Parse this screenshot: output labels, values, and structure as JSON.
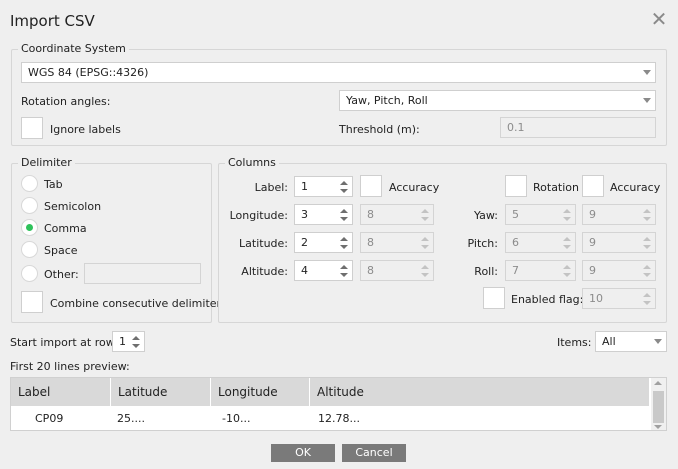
{
  "window": {
    "title": "Import CSV"
  },
  "coordinate_system": {
    "legend": "Coordinate System",
    "value": "WGS 84 (EPSG::4326)",
    "rotation_label": "Rotation angles:",
    "rotation_value": "Yaw, Pitch, Roll",
    "ignore_labels": "Ignore labels",
    "threshold_label": "Threshold (m):",
    "threshold_value": "0.1"
  },
  "delimiter": {
    "legend": "Delimiter",
    "options": [
      "Tab",
      "Semicolon",
      "Comma",
      "Space",
      "Other:"
    ],
    "selected": "Comma",
    "other_value": "",
    "combine_label": "Combine consecutive delimiters"
  },
  "columns": {
    "legend": "Columns",
    "label_label": "Label:",
    "label_value": "1",
    "accuracy_label": "Accuracy",
    "rotation_label": "Rotation",
    "accuracy2_label": "Accuracy",
    "longitude_label": "Longitude:",
    "longitude_value": "3",
    "longitude_acc": "8",
    "latitude_label": "Latitude:",
    "latitude_value": "2",
    "latitude_acc": "8",
    "altitude_label": "Altitude:",
    "altitude_value": "4",
    "altitude_acc": "8",
    "yaw_label": "Yaw:",
    "yaw_value": "5",
    "yaw_acc": "9",
    "pitch_label": "Pitch:",
    "pitch_value": "6",
    "pitch_acc": "9",
    "roll_label": "Roll:",
    "roll_value": "7",
    "roll_acc": "9",
    "enabled_label": "Enabled flag:",
    "enabled_value": "10"
  },
  "import": {
    "start_row_label": "Start import at row:",
    "start_row_value": "1",
    "items_label": "Items:",
    "items_value": "All",
    "preview_label": "First 20 lines preview:"
  },
  "preview_table": {
    "headers": [
      "Label",
      "Latitude",
      "Longitude",
      "Altitude"
    ],
    "rows": [
      [
        "CP09",
        "25....",
        "-10...",
        "12.78..."
      ]
    ]
  },
  "buttons": {
    "ok": "OK",
    "cancel": "Cancel"
  }
}
